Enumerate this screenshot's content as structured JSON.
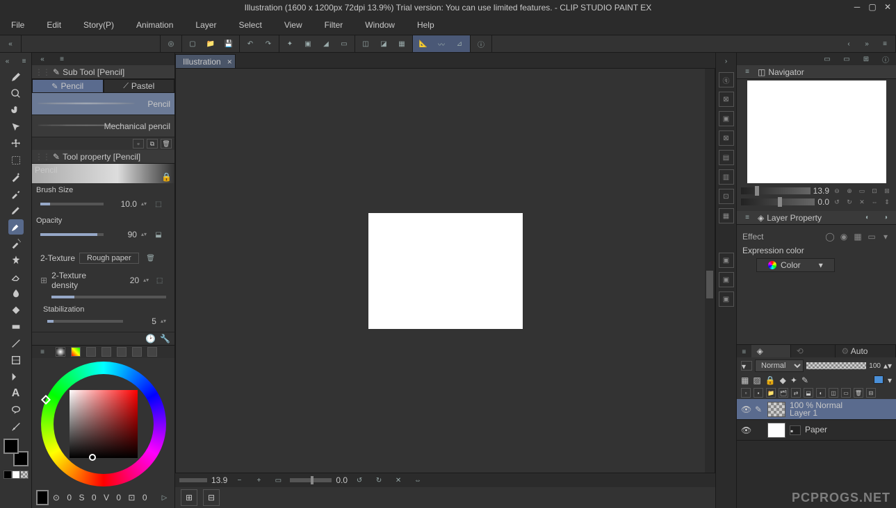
{
  "title": "Illustration (1600 x 1200px 72dpi 13.9%)  Trial version: You can use limited features. - CLIP STUDIO PAINT EX",
  "menu": [
    "File",
    "Edit",
    "Story(P)",
    "Animation",
    "Layer",
    "Select",
    "View",
    "Filter",
    "Window",
    "Help"
  ],
  "doc_tab": {
    "label": "Illustration",
    "close": "×"
  },
  "subtool": {
    "header": "Sub Tool [Pencil]",
    "tabs": [
      "Pencil",
      "Pastel"
    ],
    "brushes": [
      "Pencil",
      "Mechanical pencil"
    ]
  },
  "toolprop": {
    "header": "Tool property [Pencil]",
    "preview_label": "Pencil",
    "rows": {
      "size": {
        "label": "Brush Size",
        "value": "10.0"
      },
      "opacity": {
        "label": "Opacity",
        "value": "90"
      },
      "texture": {
        "label": "2-Texture",
        "button": "Rough paper"
      },
      "density": {
        "label": "2-Texture density",
        "value": "20"
      },
      "stab": {
        "label": "Stabilization",
        "value": "5"
      }
    }
  },
  "color_stats": {
    "a": "0",
    "b": "0",
    "c": "0",
    "d": "0"
  },
  "nav": {
    "header": "Navigator",
    "zoom": "13.9",
    "angle": "0.0"
  },
  "layerprop": {
    "header": "Layer Property",
    "effect_label": "Effect",
    "expr_label": "Expression color",
    "expr_value": "Color"
  },
  "layers": {
    "tabs": [
      "Layer",
      "History",
      "Auto Action"
    ],
    "blend": "Normal",
    "opacity": "100",
    "items": [
      {
        "info1": "100 % Normal",
        "info2": "Layer 1"
      },
      {
        "info1": "",
        "info2": "Paper"
      }
    ]
  },
  "statusbar": {
    "zoom": "13.9",
    "angle": "0.0"
  },
  "watermark": "PCPROGS.NET"
}
